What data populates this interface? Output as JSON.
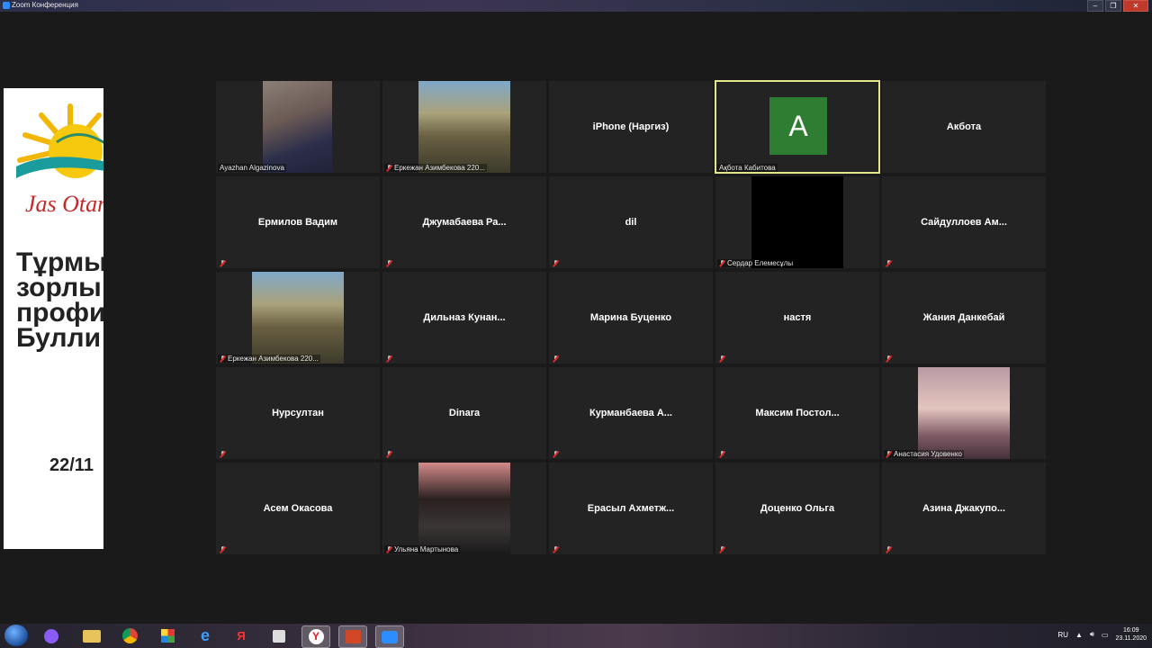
{
  "window": {
    "title": "Zoom Конференция",
    "controls": [
      "minimize",
      "maximize",
      "close"
    ]
  },
  "slide": {
    "logo_text": "Jas Otan",
    "title": "Тұрмы\nзорлы\nпрофи\nБулли",
    "date": "22/11"
  },
  "participants": [
    {
      "display": "",
      "label": "Ayazhan Algazinova",
      "muted": false,
      "video": true
    },
    {
      "display": "",
      "label": "Еркежан Азимбекова 220...",
      "muted": true,
      "video": true
    },
    {
      "display": "iPhone (Наргиз)",
      "label": "",
      "muted": false,
      "video": false
    },
    {
      "display": "A",
      "label": "Ақбота Кабитова",
      "muted": false,
      "video": false,
      "avatar": true,
      "speaking": true
    },
    {
      "display": "Акбота",
      "label": "",
      "muted": false,
      "video": false
    },
    {
      "display": "Ермилов Вадим",
      "label": "",
      "muted": true,
      "video": false
    },
    {
      "display": "Джумабаева Ра...",
      "label": "",
      "muted": true,
      "video": false
    },
    {
      "display": "dil",
      "label": "",
      "muted": true,
      "video": false
    },
    {
      "display": "",
      "label": "Сердар Елемесұлы",
      "muted": true,
      "video": true,
      "black": true
    },
    {
      "display": "Сайдуллоев Ам...",
      "label": "",
      "muted": true,
      "video": false
    },
    {
      "display": "",
      "label": "Еркежан Азимбекова 220...",
      "muted": true,
      "video": true
    },
    {
      "display": "Дильназ Кунан...",
      "label": "",
      "muted": true,
      "video": false
    },
    {
      "display": "Марина Буценко",
      "label": "",
      "muted": true,
      "video": false
    },
    {
      "display": "настя",
      "label": "",
      "muted": true,
      "video": false
    },
    {
      "display": "Жания Данкебай",
      "label": "",
      "muted": true,
      "video": false
    },
    {
      "display": "Нурсултан",
      "label": "",
      "muted": true,
      "video": false
    },
    {
      "display": "Dinara",
      "label": "",
      "muted": true,
      "video": false
    },
    {
      "display": "Курманбаева А...",
      "label": "",
      "muted": true,
      "video": false
    },
    {
      "display": "Максим Постол...",
      "label": "",
      "muted": true,
      "video": false
    },
    {
      "display": "",
      "label": "Анастасия Удовенко",
      "muted": true,
      "video": true
    },
    {
      "display": "Асем Окасова",
      "label": "",
      "muted": true,
      "video": false
    },
    {
      "display": "",
      "label": "Ульяна Мартынова",
      "muted": true,
      "video": true
    },
    {
      "display": "Ерасыл Ахметж...",
      "label": "",
      "muted": true,
      "video": false
    },
    {
      "display": "Доценко Ольга",
      "label": "",
      "muted": true,
      "video": false
    },
    {
      "display": "Азина Джакупо...",
      "label": "",
      "muted": true,
      "video": false
    }
  ],
  "taskbar": {
    "apps": [
      "start-button",
      "alice-icon",
      "explorer-icon",
      "chrome-icon",
      "rubik-icon",
      "ie-icon",
      "yandex-icon",
      "cube-icon",
      "yandex-browser-icon",
      "powerpoint-icon",
      "zoom-icon"
    ],
    "language": "RU",
    "time": "16:09",
    "date": "23.11.2020"
  },
  "colors": {
    "background": "#1a1a1a",
    "tile": "#232323",
    "speaker_outline": "#e4e68b",
    "avatar": "#2e7d32",
    "zoom_blue": "#2d8cff"
  }
}
